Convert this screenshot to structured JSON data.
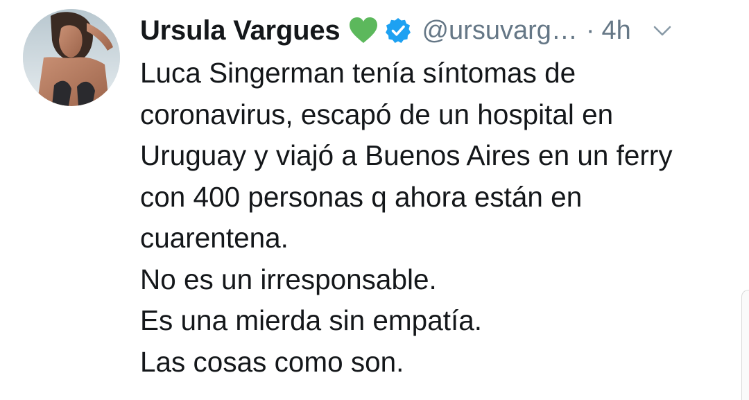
{
  "tweet": {
    "author": {
      "display_name": "Ursula Vargues",
      "emoji_icon": "green-heart-icon",
      "verified_icon": "verified-badge-icon",
      "handle": "@ursuvarg…",
      "separator": "·",
      "time": "4h"
    },
    "menu_icon": "chevron-down-icon",
    "lines": [
      "Luca Singerman tenía síntomas de",
      "coronavirus, escapó de un hospital en",
      "Uruguay y viajó a Buenos Aires en un ferry",
      "con 400 personas q ahora están en",
      "cuarentena.",
      "No es un irresponsable.",
      "Es una mierda sin empatía.",
      "Las cosas como son."
    ]
  },
  "colors": {
    "text": "#14171a",
    "secondary": "#657786",
    "verified": "#1da1f2",
    "heart": "#5cb85c"
  }
}
